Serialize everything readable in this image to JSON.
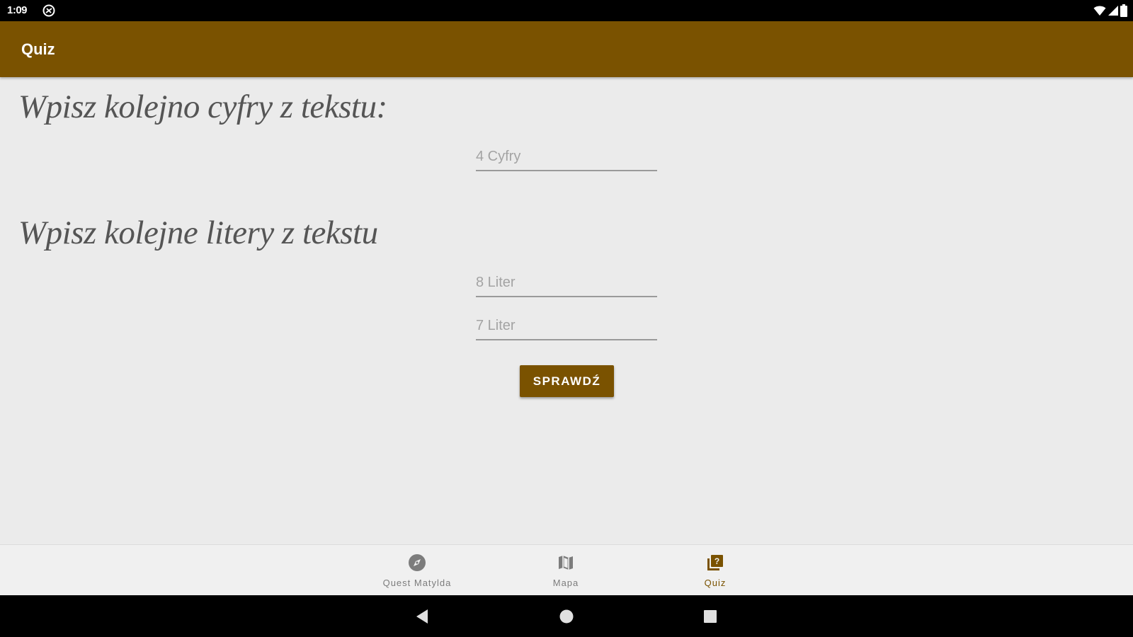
{
  "status_bar": {
    "time": "1:09",
    "icons": [
      "app-notification-icon",
      "wifi-icon",
      "cell-signal-icon",
      "battery-icon"
    ]
  },
  "app_bar": {
    "title": "Quiz"
  },
  "content": {
    "digits_heading": "Wpisz kolejno cyfry z tekstu:",
    "digits_input": {
      "placeholder": "4 Cyfry",
      "value": ""
    },
    "letters_heading": "Wpisz kolejne litery z tekstu",
    "letters_input_1": {
      "placeholder": "8 Liter",
      "value": ""
    },
    "letters_input_2": {
      "placeholder": "7 Liter",
      "value": ""
    },
    "check_button_label": "SPRAWDŹ"
  },
  "bottom_nav": {
    "items": [
      {
        "label": "Quest Matylda",
        "icon": "compass-icon",
        "active": false
      },
      {
        "label": "Mapa",
        "icon": "map-icon",
        "active": false
      },
      {
        "label": "Quiz",
        "icon": "quiz-icon",
        "active": true
      }
    ]
  },
  "system_nav": {
    "buttons": [
      "back-icon",
      "home-icon",
      "recents-icon"
    ]
  },
  "colors": {
    "primary": "#7a5200",
    "background": "#ebebeb",
    "nav_inactive": "#7c7c7c",
    "heading_text": "#555555"
  }
}
